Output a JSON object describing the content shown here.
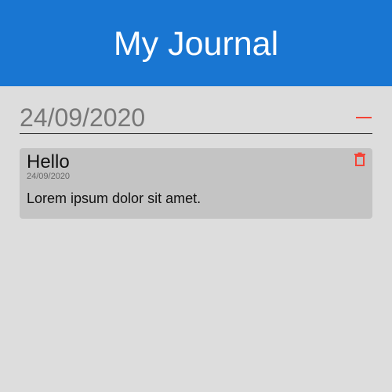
{
  "app": {
    "title": "My Journal",
    "accent_color": "#1976d2"
  },
  "date_picker": {
    "value": "24/09/2020",
    "collapse_icon": "minus-icon",
    "icon_color": "#f44336"
  },
  "entries": [
    {
      "title": "Hello",
      "date": "24/09/2020",
      "body": "Lorem ipsum dolor sit amet.",
      "delete_icon": "trash-icon"
    }
  ]
}
